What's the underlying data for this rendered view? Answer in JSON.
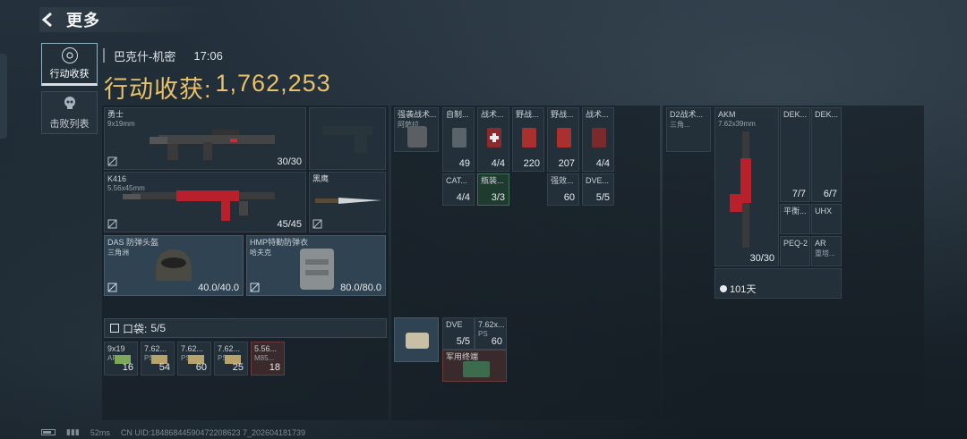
{
  "header": {
    "title": "更多"
  },
  "side_tabs": [
    {
      "label": "行动收获",
      "active": true
    },
    {
      "label": "击败列表",
      "active": false
    }
  ],
  "match": {
    "map": "巴克什-机密",
    "time": "17:06"
  },
  "gain": {
    "label": "行动收获:",
    "value": "1,762,253"
  },
  "weapons": {
    "primary": {
      "name": "勇士",
      "ammo": "9x19mm",
      "count": "30/30"
    },
    "secondary": {
      "name": "K416",
      "ammo": "5.56x45mm",
      "count": "45/45"
    },
    "melee": {
      "name": "黑鹰"
    }
  },
  "armor": {
    "helmet": {
      "name": "DAS 防弹头盔",
      "sub": "三角洲",
      "durability": "40.0/40.0"
    },
    "vest": {
      "name": "HMP特勤防弹衣",
      "sub": "哈夫克",
      "durability": "80.0/80.0"
    }
  },
  "pocket": {
    "label": "口袋:",
    "value": "5/5",
    "items": [
      {
        "name": "9x19",
        "sub": "AP6.3",
        "count": "16"
      },
      {
        "name": "7.62...",
        "sub": "PS",
        "count": "54"
      },
      {
        "name": "7.62...",
        "sub": "PS",
        "count": "60"
      },
      {
        "name": "7.62...",
        "sub": "PS",
        "count": "25"
      },
      {
        "name": "5.56...",
        "sub": "M85...",
        "count": "18"
      }
    ]
  },
  "vest_items": [
    {
      "name": "强袭战术...",
      "sub": "阿萨拉"
    },
    {
      "name": "自制...",
      "count": "49"
    },
    {
      "name": "战术...",
      "count": "4/4"
    },
    {
      "name": "野战...",
      "count": "220"
    },
    {
      "name": "野战...",
      "count": "207"
    },
    {
      "name": "战术...",
      "count": "4/4"
    },
    {
      "name": "CAT...",
      "count": "4/4"
    },
    {
      "name": "瓶装...",
      "count": "3/3"
    },
    {
      "name": "强效...",
      "count": "60"
    },
    {
      "name": "DVE...",
      "count": "5/5"
    }
  ],
  "backpack_items": [
    {
      "name": "DVE",
      "count": "5/5"
    },
    {
      "name": "7.62x...",
      "sub": "PS",
      "count": "60"
    },
    {
      "name": "军用终端"
    }
  ],
  "right_panel": {
    "bag": {
      "name": "D2战术...",
      "sub": "三角..."
    },
    "rifle": {
      "name": "AKM",
      "ammo": "7.62x39mm",
      "count": "30/30",
      "days": "101天"
    },
    "mods": [
      {
        "name": "DEK...",
        "count": "7/7"
      },
      {
        "name": "DEK...",
        "count": "6/7"
      },
      {
        "name": "平衡..."
      },
      {
        "name": "UHX"
      },
      {
        "name": "PEQ-2"
      },
      {
        "name": "AR",
        "sub": "重塔..."
      }
    ]
  },
  "footer": {
    "ping": "52ms",
    "uid": "CN UID:18486844590472208623 7_202604181739"
  }
}
